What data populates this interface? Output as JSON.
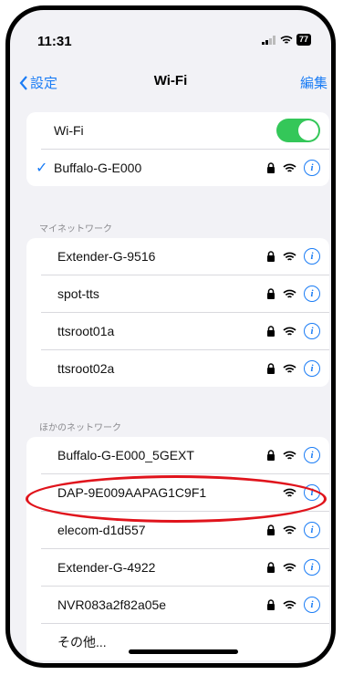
{
  "status": {
    "time": "11:31",
    "battery": "77"
  },
  "nav": {
    "back_label": "設定",
    "title": "Wi-Fi",
    "edit_label": "編集"
  },
  "wifi": {
    "label": "Wi-Fi",
    "enabled": true,
    "connected": "Buffalo-G-E000"
  },
  "sections": {
    "my_networks": "マイネットワーク",
    "other_networks": "ほかのネットワーク"
  },
  "my_networks": [
    "Extender-G-9516",
    "spot-tts",
    "ttsroot01a",
    "ttsroot02a"
  ],
  "other_networks": [
    "Buffalo-G-E000_5GEXT",
    "DAP-9E009AAPAG1C9F1",
    "elecom-d1d557",
    "Extender-G-4922",
    "NVR083a2f82a05e"
  ],
  "other_label": "その他...",
  "colors": {
    "accent": "#1a7cf5",
    "toggle_on": "#34c759",
    "annotation": "#e0141c"
  }
}
